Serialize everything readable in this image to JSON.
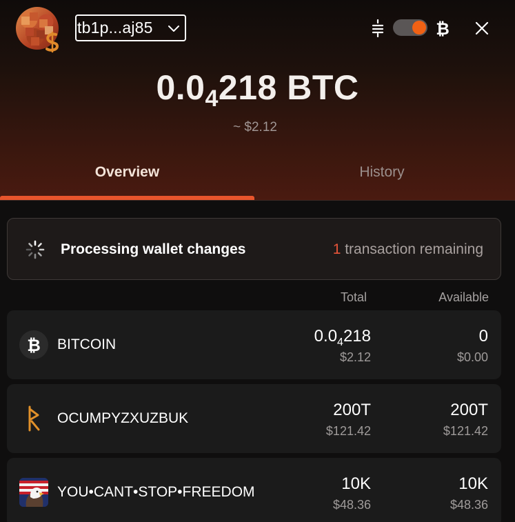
{
  "header": {
    "address": "tb1p...aj85",
    "balance_main": "0.0",
    "balance_subscript": "4",
    "balance_rest": "218 BTC",
    "fiat_value": "~ $2.12",
    "unit_toggle": {
      "left_icon": "satoshi-icon",
      "right_icon": "bitcoin-icon",
      "state": "btc"
    }
  },
  "tabs": [
    {
      "label": "Overview",
      "active": true
    },
    {
      "label": "History",
      "active": false
    }
  ],
  "processing": {
    "label": "Processing wallet changes",
    "count": "1",
    "remaining_text": " transaction remaining"
  },
  "columns": {
    "total": "Total",
    "available": "Available"
  },
  "assets": [
    {
      "name": "BITCOIN",
      "icon": "bitcoin-icon",
      "total_main": "0.0",
      "total_sub": "4",
      "total_rest": "218",
      "total_usd": "$2.12",
      "available": "0",
      "available_usd": "$0.00"
    },
    {
      "name": "OCUMPYZXUZBUK",
      "icon": "rune-icon",
      "total": "200T",
      "total_usd": "$121.42",
      "available": "200T",
      "available_usd": "$121.42"
    },
    {
      "name": "YOU•CANT•STOP•FREEDOM",
      "icon": "eagle-flag-icon",
      "total": "10K",
      "total_usd": "$48.36",
      "available": "10K",
      "available_usd": "$48.36"
    }
  ],
  "colors": {
    "accent": "#e8552c",
    "toggle_knob": "#f06114",
    "count_highlight": "#e9553a",
    "row_bg": "#1b1b1b"
  }
}
